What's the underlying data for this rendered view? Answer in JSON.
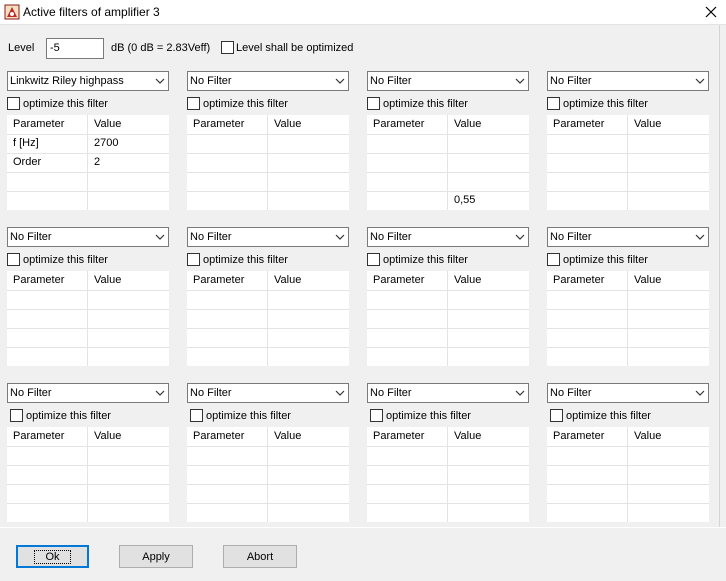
{
  "window": {
    "title": "Active filters of amplifier 3",
    "close_symbol": "X"
  },
  "level": {
    "label": "Level",
    "value": "-5",
    "unit_text": "dB (0 dB = 2.83Veff)",
    "optimize_label": "Level shall be optimized",
    "optimize_checked": false
  },
  "filters": [
    {
      "type": "Linkwitz Riley highpass",
      "optimize_label": "optimize this filter",
      "headers": [
        "Parameter",
        "Value"
      ],
      "rows": [
        [
          "f [Hz]",
          "2700"
        ],
        [
          "Order",
          "2"
        ],
        [
          "",
          ""
        ],
        [
          "",
          ""
        ]
      ]
    },
    {
      "type": "No Filter",
      "optimize_label": "optimize this filter",
      "headers": [
        "Parameter",
        "Value"
      ],
      "rows": [
        [
          "",
          ""
        ],
        [
          "",
          ""
        ],
        [
          "",
          ""
        ],
        [
          "",
          ""
        ]
      ]
    },
    {
      "type": "No Filter",
      "optimize_label": "optimize this filter",
      "headers": [
        "Parameter",
        "Value"
      ],
      "rows": [
        [
          "",
          ""
        ],
        [
          "",
          ""
        ],
        [
          "",
          ""
        ],
        [
          "",
          "0,55"
        ]
      ]
    },
    {
      "type": "No Filter",
      "optimize_label": "optimize this filter",
      "headers": [
        "Parameter",
        "Value"
      ],
      "rows": [
        [
          "",
          ""
        ],
        [
          "",
          ""
        ],
        [
          "",
          ""
        ],
        [
          "",
          ""
        ]
      ]
    },
    {
      "type": "No Filter",
      "optimize_label": "optimize this filter",
      "headers": [
        "Parameter",
        "Value"
      ],
      "rows": [
        [
          "",
          ""
        ],
        [
          "",
          ""
        ],
        [
          "",
          ""
        ],
        [
          "",
          ""
        ]
      ]
    },
    {
      "type": "No Filter",
      "optimize_label": "optimize this filter",
      "headers": [
        "Parameter",
        "Value"
      ],
      "rows": [
        [
          "",
          ""
        ],
        [
          "",
          ""
        ],
        [
          "",
          ""
        ],
        [
          "",
          ""
        ]
      ]
    },
    {
      "type": "No Filter",
      "optimize_label": "optimize this filter",
      "headers": [
        "Parameter",
        "Value"
      ],
      "rows": [
        [
          "",
          ""
        ],
        [
          "",
          ""
        ],
        [
          "",
          ""
        ],
        [
          "",
          ""
        ]
      ]
    },
    {
      "type": "No Filter",
      "optimize_label": "optimize this filter",
      "headers": [
        "Parameter",
        "Value"
      ],
      "rows": [
        [
          "",
          ""
        ],
        [
          "",
          ""
        ],
        [
          "",
          ""
        ],
        [
          "",
          ""
        ]
      ]
    },
    {
      "type": "No Filter",
      "optimize_label": "optimize this filter",
      "headers": [
        "Parameter",
        "Value"
      ],
      "rows": [
        [
          "",
          ""
        ],
        [
          "",
          ""
        ],
        [
          "",
          ""
        ],
        [
          "",
          ""
        ]
      ]
    },
    {
      "type": "No Filter",
      "optimize_label": "optimize this filter",
      "headers": [
        "Parameter",
        "Value"
      ],
      "rows": [
        [
          "",
          ""
        ],
        [
          "",
          ""
        ],
        [
          "",
          ""
        ],
        [
          "",
          ""
        ]
      ]
    },
    {
      "type": "No Filter",
      "optimize_label": "optimize this filter",
      "headers": [
        "Parameter",
        "Value"
      ],
      "rows": [
        [
          "",
          ""
        ],
        [
          "",
          ""
        ],
        [
          "",
          ""
        ],
        [
          "",
          ""
        ]
      ]
    },
    {
      "type": "No Filter",
      "optimize_label": "optimize this filter",
      "headers": [
        "Parameter",
        "Value"
      ],
      "rows": [
        [
          "",
          ""
        ],
        [
          "",
          ""
        ],
        [
          "",
          ""
        ],
        [
          "",
          ""
        ]
      ]
    }
  ],
  "buttons": {
    "ok": "Ok",
    "apply": "Apply",
    "abort": "Abort"
  }
}
